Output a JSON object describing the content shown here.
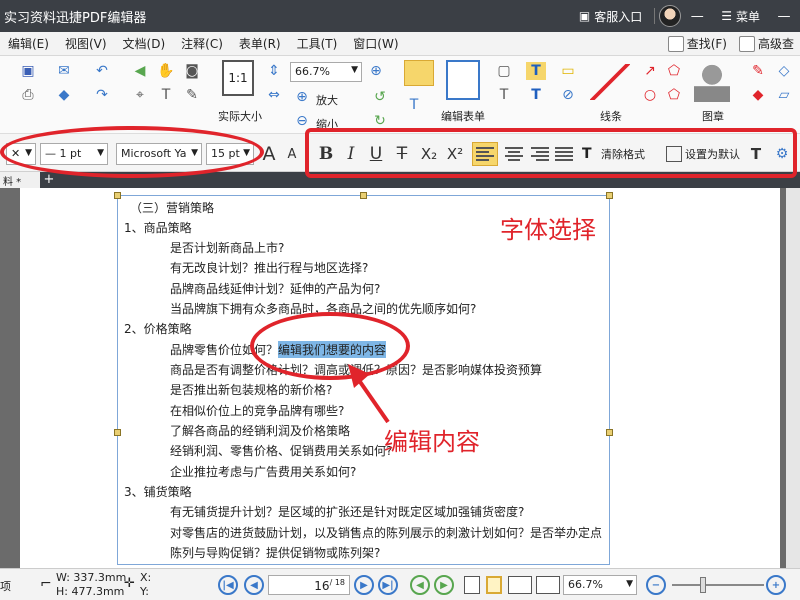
{
  "titlebar": {
    "title": "实习资料迅捷PDF编辑器",
    "service": "客服入口",
    "menu": "菜单",
    "minimize": "—",
    "close": "✕"
  },
  "menubar": {
    "items": [
      "编辑(E)",
      "视图(V)",
      "文档(D)",
      "注释(C)",
      "表单(R)",
      "工具(T)",
      "窗口(W)"
    ],
    "find": "查找(F)",
    "advanced": "高级查"
  },
  "ribbon": {
    "zoom_value": "66.7%",
    "actual_size": "实际大小",
    "zoom_in": "放大",
    "zoom_out": "缩小",
    "edit_form": "编辑表单",
    "lines": "线条",
    "stamp": "图章"
  },
  "formatbar": {
    "line_width": "1 pt",
    "font_family": "Microsoft Ya",
    "font_size": "15 pt",
    "clear_format": "清除格式",
    "set_default": "设置为默认",
    "bold": "B",
    "italic": "I",
    "underline": "U",
    "strike": "T",
    "subscript": "X₂",
    "superscript": "X²",
    "grow_font": "A",
    "shrink_font": "A"
  },
  "tabs": {
    "doc_tab": "料 *",
    "add": "+"
  },
  "annotations": {
    "font_select": "字体选择",
    "edit_content": "编辑内容",
    "color": "#e0242b"
  },
  "document": {
    "lines": [
      "（三）营销策略",
      "1、商品策略",
      "是否计划新商品上市?",
      "有无改良计划？推出行程与地区选择?",
      "品牌商品线延伸计划？延伸的产品为何?",
      "当品牌旗下拥有众多商品时，各商品之间的优先顺序如何?",
      "2、价格策略",
      "品牌零售价位如何？",
      "编辑我们想要的内容",
      "商品是否有调整价格计划？调高或调低？原因？是否影响媒体投资预算",
      "是否推出新包装规格的新价格?",
      "在相似价位上的竞争品牌有哪些?",
      "了解各商品的经销利润及价格策略",
      "经销利润、零售价格、促销费用关系如何?",
      "企业推拉考虑与广告费用关系如何?",
      "3、铺货策略",
      "有无铺货提升计划？是区域的扩张还是针对既定区域加强铺货密度?",
      "对零售店的进货鼓励计划，以及销售点的陈列展示的刺激计划如何？是否举办定点",
      "陈列与导购促销？提供促销物或陈列架?"
    ]
  },
  "statusbar": {
    "mode": "项",
    "width": "W: 337.3mm",
    "height": "H: 477.3mm",
    "x": "X:",
    "y": "Y:",
    "current_page": "16",
    "total_pages": "/ 18",
    "zoom": "66.7%"
  }
}
